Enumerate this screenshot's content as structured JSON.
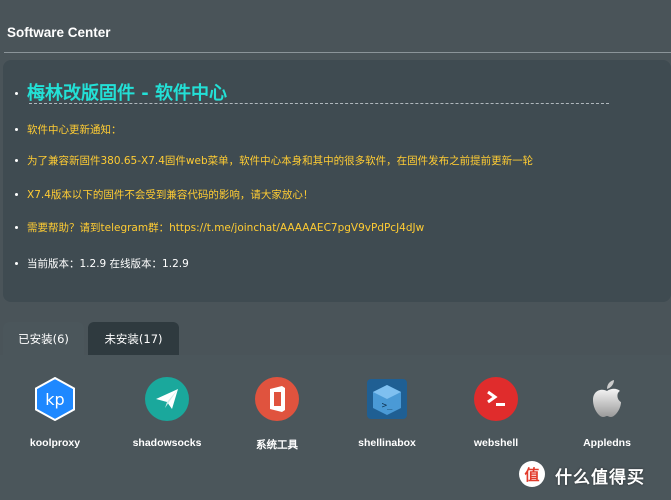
{
  "header": {
    "title": "Software Center"
  },
  "notice": {
    "heading": "梅林改版固件 - 软件中心",
    "items": [
      "软件中心更新通知：",
      "为了兼容新固件380.65-X7.4固件web菜单，软件中心本身和其中的很多软件，在固件发布之前提前更新一轮",
      "X7.4版本以下的固件不会受到兼容代码的影响，请大家放心！",
      "需要帮助？请到telegram群：https://t.me/joinchat/AAAAAEC7pgV9vPdPcJ4dJw",
      "当前版本：1.2.9 在线版本：1.2.9"
    ],
    "colors": {
      "heading": "#23e0d6",
      "text": "#ffcc33",
      "version_text": "#ffffff"
    }
  },
  "tabs": [
    {
      "label": "已安装(6)",
      "active": true
    },
    {
      "label": "未安装(17)",
      "active": false
    }
  ],
  "apps": [
    {
      "name": "koolproxy",
      "icon": "kp-hexagon-icon",
      "color": "#1e88ff"
    },
    {
      "name": "shadowsocks",
      "icon": "paper-plane-icon",
      "color": "#1aa89c"
    },
    {
      "name": "系统工具",
      "icon": "office-logo-icon",
      "color": "#e0533e"
    },
    {
      "name": "shellinabox",
      "icon": "terminal-box-icon",
      "color": "#1f5f93"
    },
    {
      "name": "webshell",
      "icon": "shell-prompt-icon",
      "color": "#e02c2c"
    },
    {
      "name": "Appledns",
      "icon": "apple-logo-icon",
      "color": "#e8e8e8"
    }
  ],
  "watermark": {
    "badge": "值",
    "text": "什么值得买"
  }
}
